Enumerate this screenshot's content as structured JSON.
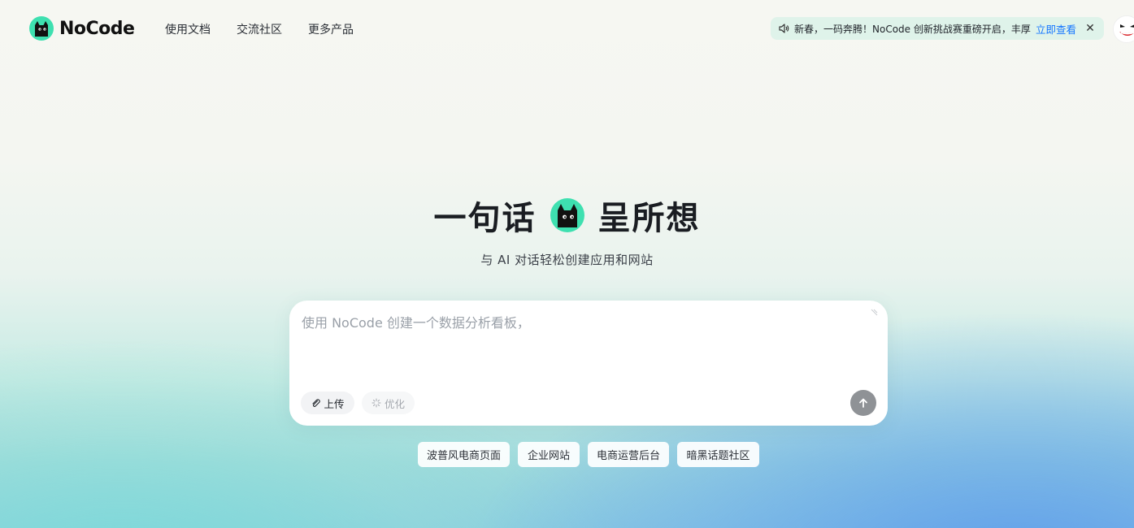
{
  "brand": {
    "name": "NoCode",
    "logo_icon": "black-cat-logo-icon"
  },
  "nav": {
    "items": [
      {
        "label": "使用文档"
      },
      {
        "label": "交流社区"
      },
      {
        "label": "更多产品"
      }
    ]
  },
  "announcement": {
    "icon": "speaker-icon",
    "text": "新春，一码奔腾！NoCode 创新挑战赛重磅开启，丰厚",
    "link_label": "立即查看",
    "close_icon": "close-icon"
  },
  "hero": {
    "title_left": "一句话",
    "title_right": "呈所想",
    "subtitle": "与 AI 对话轻松创建应用和网站"
  },
  "prompt": {
    "placeholder": "使用 NoCode 创建一个数据分析看板，",
    "value": "",
    "upload_label": "上传",
    "optimize_label": "优化",
    "send_icon": "arrow-up-icon"
  },
  "suggestions": [
    {
      "label": "波普风电商页面"
    },
    {
      "label": "企业网站"
    },
    {
      "label": "电商运营后台"
    },
    {
      "label": "暗黑话题社区"
    }
  ],
  "colors": {
    "accent": "#1677ff",
    "logo_green": "#3ee0b0",
    "announce_bg": "#dff3ea",
    "send_button": "#8f9296"
  }
}
